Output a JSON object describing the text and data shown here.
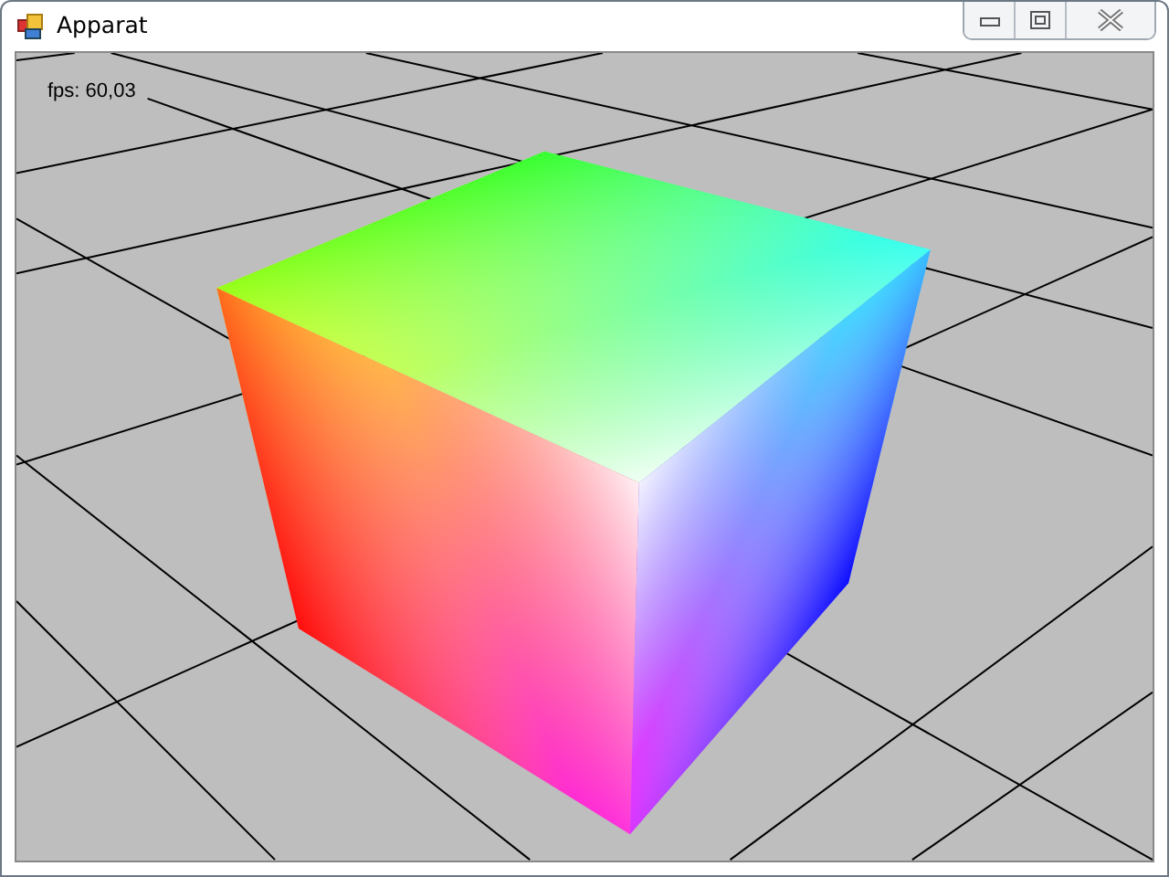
{
  "window": {
    "title": "Apparat"
  },
  "viewport": {
    "overlay_text": "fps: 60,03"
  }
}
